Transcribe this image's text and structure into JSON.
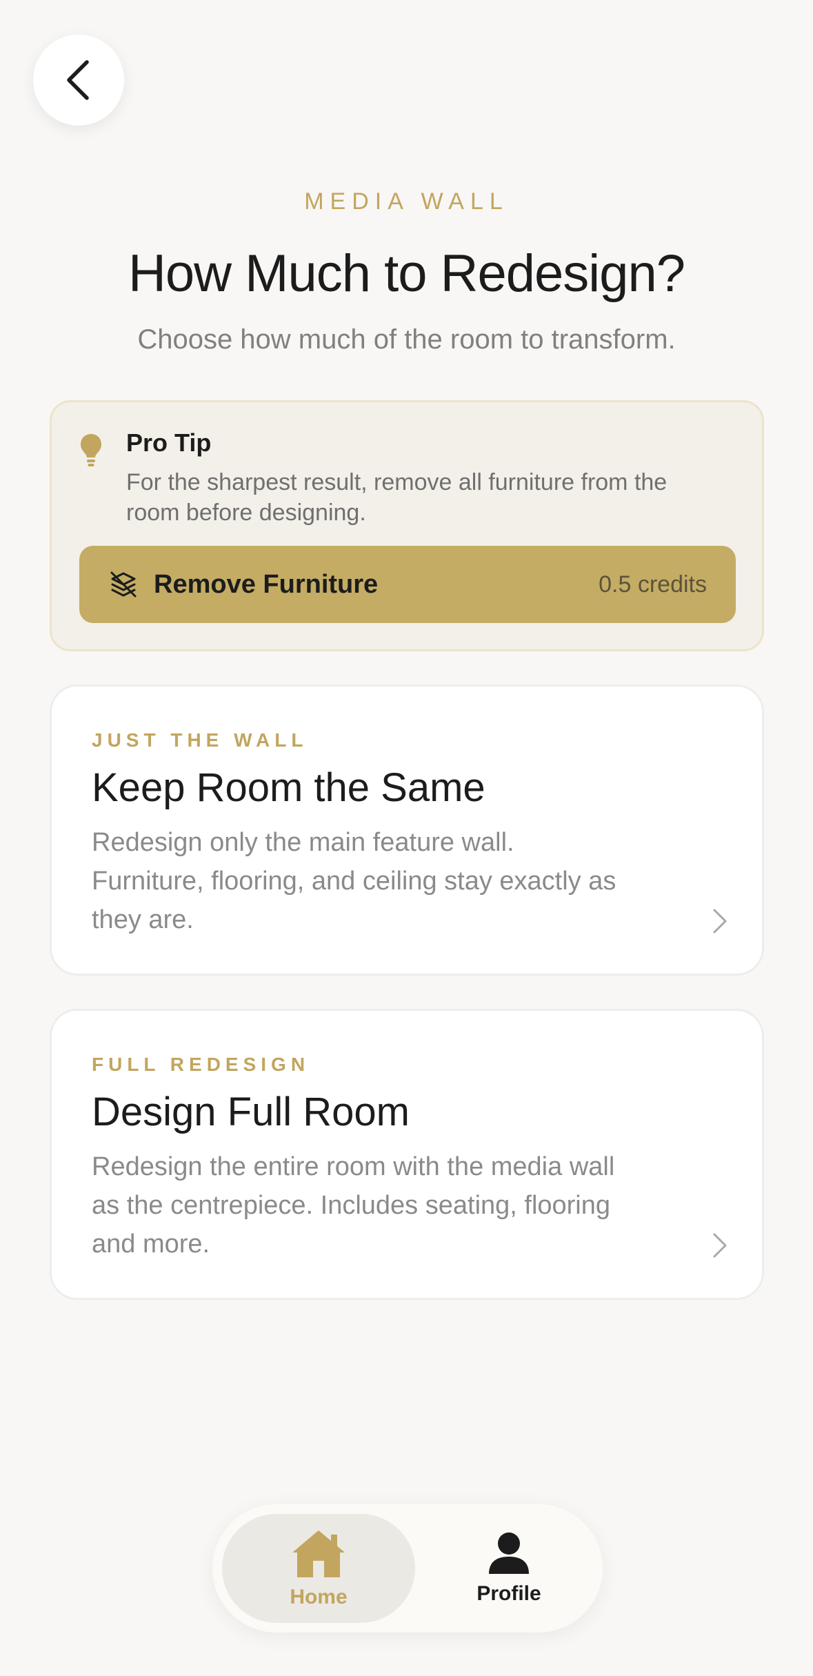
{
  "header": {
    "eyebrow": "MEDIA WALL",
    "title": "How Much to Redesign?",
    "subtitle": "Choose how much of the room to transform."
  },
  "tip": {
    "title": "Pro Tip",
    "text": "For the sharpest result, remove all furniture from the room before designing.",
    "button_label": "Remove Furniture",
    "button_credits": "0.5 credits",
    "icon": "lightbulb-icon"
  },
  "options": [
    {
      "eyebrow": "JUST THE WALL",
      "title": "Keep Room the Same",
      "description": "Redesign only the main feature wall. Furniture, flooring, and ceiling stay exactly as they are."
    },
    {
      "eyebrow": "FULL REDESIGN",
      "title": "Design Full Room",
      "description": "Redesign the entire room with the media wall as the centrepiece. Includes seating, flooring and more."
    }
  ],
  "nav": {
    "home_label": "Home",
    "profile_label": "Profile",
    "active": "home"
  },
  "colors": {
    "accent": "#c2a55e",
    "button": "#c4ac64",
    "tip_background": "#f3f0e9",
    "page_background": "#f8f7f5"
  }
}
